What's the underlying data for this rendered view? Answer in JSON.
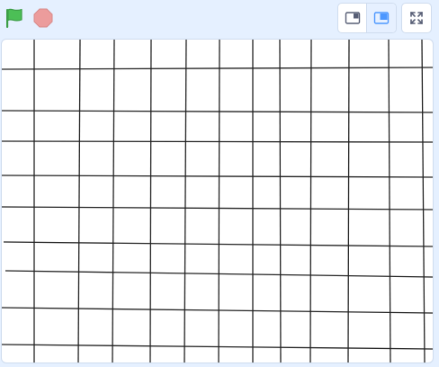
{
  "controls": {
    "green_flag": {
      "icon": "green-flag-icon",
      "color": "#4cbf56"
    },
    "stop": {
      "icon": "stop-sign-icon",
      "color": "#ec9c9c"
    },
    "small_stage_icon": "small-stage-layout-icon",
    "large_stage_icon": "large-stage-layout-icon",
    "fullscreen_icon": "fullscreen-icon",
    "accent": "#4c97ff"
  },
  "stage": {
    "background": "#ffffff",
    "drawing": "pen-grid",
    "line_color": "#222222"
  }
}
